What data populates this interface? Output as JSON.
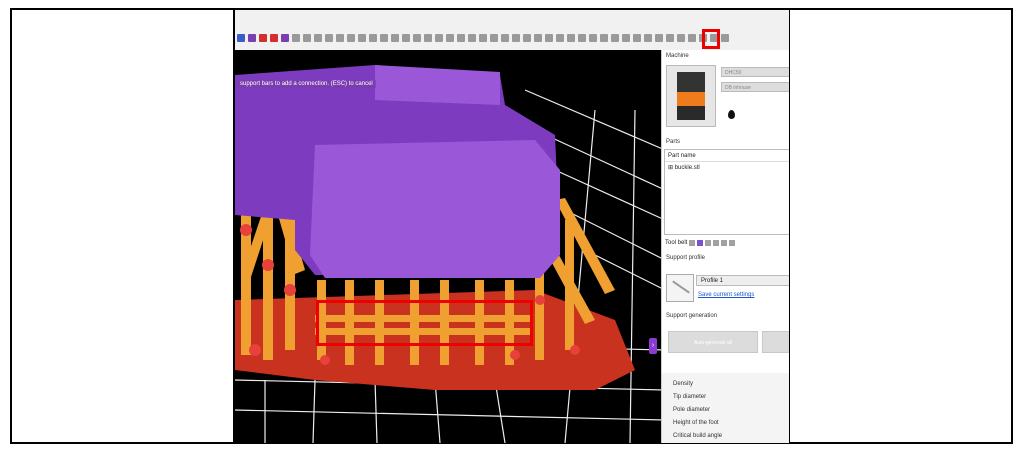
{
  "toolbar": {
    "icons": [
      "grid-icon",
      "support-icon",
      "dot-red-icon",
      "dot-red-icon",
      "table-icon",
      "tool-icon",
      "tool-icon",
      "tool-icon",
      "tool-icon",
      "tool-icon",
      "tool-icon",
      "tool-icon",
      "tool-icon",
      "tool-icon",
      "tool-icon",
      "tool-icon",
      "tool-icon",
      "tool-icon",
      "tool-icon",
      "tool-icon",
      "tool-icon",
      "circle-icon",
      "circle-icon",
      "circle-icon",
      "circle-icon",
      "circle-icon",
      "circle-icon",
      "circle-icon",
      "circle-icon",
      "tool-icon",
      "tool-icon",
      "tool-icon",
      "tool-icon",
      "tool-icon",
      "tool-icon",
      "tool-icon",
      "tool-icon",
      "tool-icon",
      "tool-icon",
      "tool-icon",
      "support-bar-icon",
      "tool-icon",
      "tool-icon",
      "tool-icon",
      "tool-icon"
    ]
  },
  "viewport": {
    "status_message": "support bars to add a connection. (ESC) to cancel",
    "colors": {
      "model": "#8b46c8",
      "supports": "#f0a030",
      "raft": "#c8321e",
      "background": "#000000"
    }
  },
  "panel": {
    "machine_title": "Machine",
    "machine_field_1": "DHC50",
    "machine_field_2": "DB inhouse",
    "resin_text": "",
    "parts_title": "Parts",
    "parts_header": "Part name",
    "parts_item": "⊞ buckle.stl",
    "tool_belt_label": "Tool belt",
    "support_profile_title": "Support profile",
    "profile_value": "Profile 1",
    "save_link": "Save current settings",
    "support_generation_title": "Support generation",
    "auto_generate_label": "Auto-generate all",
    "params": [
      "Density",
      "Tip diameter",
      "Pole diameter",
      "Height of the foot",
      "Critical build angle"
    ]
  }
}
